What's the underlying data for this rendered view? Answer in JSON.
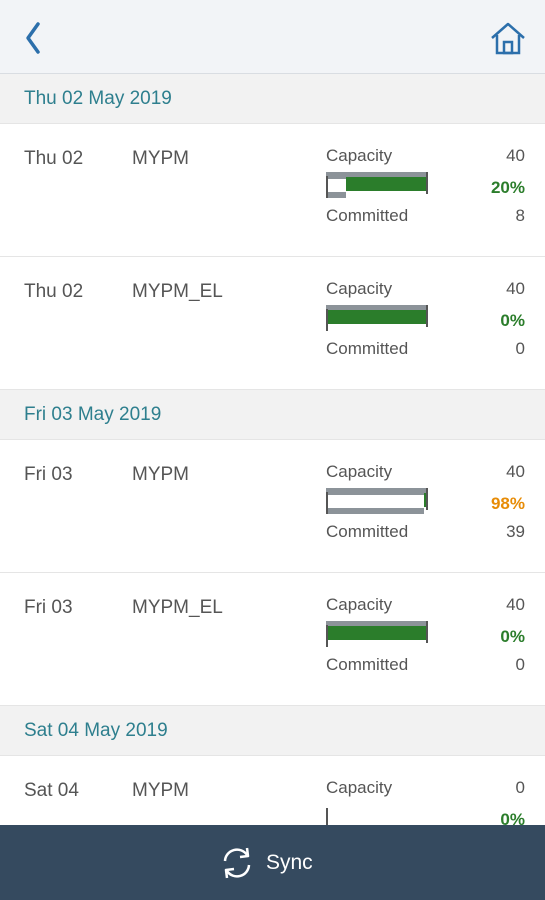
{
  "nav": {
    "back_icon": "chevron-left-icon",
    "home_icon": "home-icon"
  },
  "colors": {
    "accent": "#2e7f8e",
    "green": "#2b7d2b",
    "orange": "#e78c07",
    "footer_bg": "#354a5f"
  },
  "labels": {
    "capacity": "Capacity",
    "committed": "Committed"
  },
  "groups": [
    {
      "title": "Thu 02 May 2019",
      "items": [
        {
          "date": "Thu 02",
          "name": "MYPM",
          "capacity": "40",
          "percent": "20%",
          "percent_color": "green",
          "committed": "8",
          "fill_fraction": 0.8,
          "committed_fraction": 0.2,
          "capacity_fraction": 1.0
        },
        {
          "date": "Thu 02",
          "name": "MYPM_EL",
          "capacity": "40",
          "percent": "0%",
          "percent_color": "green",
          "committed": "0",
          "fill_fraction": 1.0,
          "committed_fraction": 0.0,
          "capacity_fraction": 1.0
        }
      ]
    },
    {
      "title": "Fri 03 May 2019",
      "items": [
        {
          "date": "Fri 03",
          "name": "MYPM",
          "capacity": "40",
          "percent": "98%",
          "percent_color": "orange",
          "committed": "39",
          "fill_fraction": 0.02,
          "committed_fraction": 0.98,
          "capacity_fraction": 1.0
        },
        {
          "date": "Fri 03",
          "name": "MYPM_EL",
          "capacity": "40",
          "percent": "0%",
          "percent_color": "green",
          "committed": "0",
          "fill_fraction": 1.0,
          "committed_fraction": 0.0,
          "capacity_fraction": 1.0
        }
      ]
    },
    {
      "title": "Sat 04 May 2019",
      "items": [
        {
          "date": "Sat 04",
          "name": "MYPM",
          "capacity": "0",
          "percent": "0%",
          "percent_color": "green",
          "committed": "",
          "fill_fraction": 0.0,
          "committed_fraction": 0.0,
          "capacity_fraction": 0.0
        }
      ]
    }
  ],
  "footer": {
    "sync_label": "Sync",
    "sync_icon": "sync-icon"
  }
}
